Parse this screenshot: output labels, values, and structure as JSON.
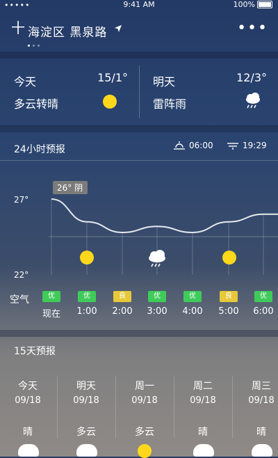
{
  "status_bar": {
    "signal": "•••••",
    "time": "9:41 AM",
    "battery": "100%"
  },
  "header": {
    "add_label": "十",
    "location": "海淀区 黑泉路",
    "more_label": "•••"
  },
  "today": [
    {
      "name": "今天",
      "temp": "15/1°",
      "desc": "多云转晴",
      "icon": "sun-icon"
    },
    {
      "name": "明天",
      "temp": "12/3°",
      "desc": "雷阵雨",
      "icon": "thunder-rain-icon"
    }
  ],
  "hourly": {
    "title": "24小时预报",
    "sunrise": "06:00",
    "sunset": "19:29",
    "tooltip": "26° 阴",
    "aqi_label": "空气",
    "hours": [
      "现在",
      "1:00",
      "2:00",
      "3:00",
      "4:00",
      "5:00",
      "6:00"
    ],
    "aqi": [
      "优",
      "优",
      "良",
      "优",
      "优",
      "良",
      "优"
    ],
    "colors": {
      "good": "#3fcb59",
      "moderate": "#e6c93a"
    }
  },
  "chart_data": {
    "type": "line",
    "x": [
      "现在",
      "1:00",
      "2:00",
      "3:00",
      "4:00",
      "5:00",
      "6:00"
    ],
    "values": [
      27,
      25.5,
      24.8,
      25.2,
      24.8,
      25.5,
      26
    ],
    "ylim": [
      22,
      27
    ],
    "ytick_labels": [
      "27°",
      "22°"
    ]
  },
  "daily": {
    "title": "15天预报",
    "days": [
      {
        "name": "今天",
        "date": "09/18",
        "weather": "晴"
      },
      {
        "name": "明天",
        "date": "09/18",
        "weather": "多云"
      },
      {
        "name": "周一",
        "date": "09/18",
        "weather": "多云"
      },
      {
        "name": "周二",
        "date": "09/18",
        "weather": "晴"
      },
      {
        "name": "周三",
        "date": "09/18",
        "weather": "晴"
      }
    ]
  }
}
